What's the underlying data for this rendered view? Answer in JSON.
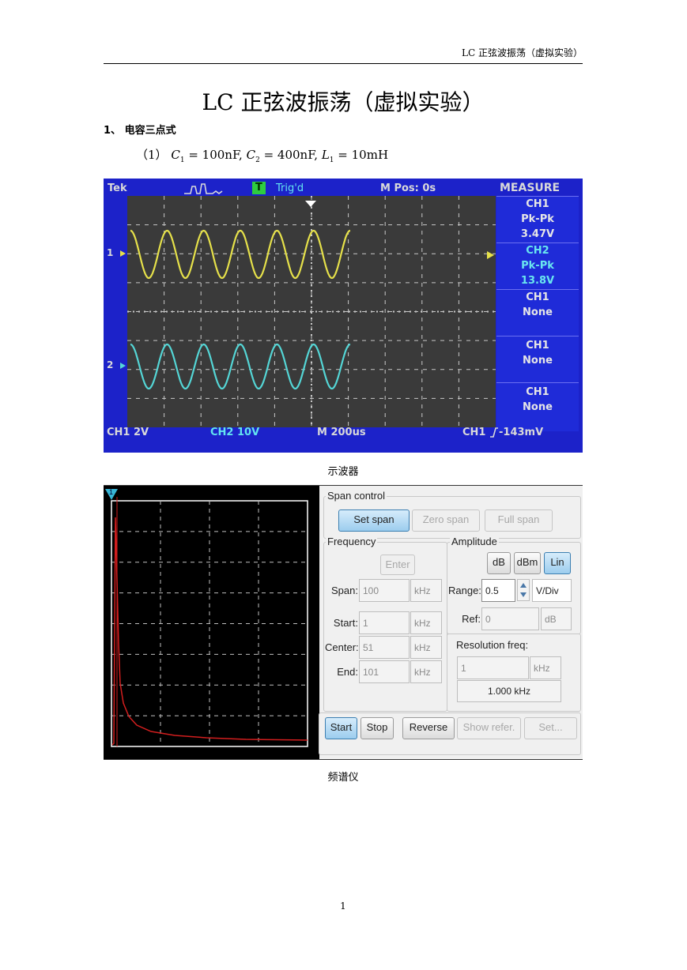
{
  "header": {
    "running_title": "LC 正弦波振荡（虚拟实验）"
  },
  "title": "LC 正弦波振荡（虚拟实验）",
  "section": {
    "heading": "1、 电容三点式"
  },
  "params": {
    "index": "（1）",
    "c1": "100nF",
    "c2": "400nF",
    "l1": "10mH"
  },
  "oscilloscope": {
    "brand": "Tek",
    "trigger_badge": "T",
    "trigger_status": "Trig'd",
    "m_pos": "M Pos: 0s",
    "menu_title": "MEASURE",
    "measurements": [
      {
        "line1": "CH1",
        "line2": "Pk-Pk",
        "line3": "3.47V"
      },
      {
        "line1": "CH2",
        "line2": "Pk-Pk",
        "line3": "13.8V"
      },
      {
        "line1": "CH1",
        "line2": "None",
        "line3": ""
      },
      {
        "line1": "CH1",
        "line2": "None",
        "line3": ""
      },
      {
        "line1": "CH1",
        "line2": "None",
        "line3": ""
      }
    ],
    "ch1_marker": "1",
    "ch2_marker": "2",
    "ch1_scale": "CH1 2V",
    "ch2_scale": "CH2 10V",
    "timebase": "M 200us",
    "trigger_level": "CH1",
    "trigger_value": "-143mV",
    "colors": {
      "background": "#1c22c9",
      "grid": "#c8c8c8",
      "ch1": "#e6e14a",
      "ch2": "#54d6d6"
    },
    "waves": {
      "ch1_cycles": 6,
      "ch2_cycles": 6
    }
  },
  "oscilloscope_caption": "示波器",
  "spectrum": {
    "marker": "1",
    "span_control": {
      "title": "Span control",
      "set_span": "Set span",
      "zero_span": "Zero span",
      "full_span": "Full span"
    },
    "frequency": {
      "title": "Frequency",
      "enter": "Enter",
      "span_label": "Span:",
      "span_value": "100",
      "span_unit": "kHz",
      "start_label": "Start:",
      "start_value": "1",
      "start_unit": "kHz",
      "center_label": "Center:",
      "center_value": "51",
      "center_unit": "kHz",
      "end_label": "End:",
      "end_value": "101",
      "end_unit": "kHz"
    },
    "amplitude": {
      "title": "Amplitude",
      "db": "dB",
      "dbm": "dBm",
      "lin": "Lin",
      "range_label": "Range:",
      "range_value": "0.5",
      "range_unit": "V/Div",
      "ref_label": "Ref:",
      "ref_value": "0",
      "ref_unit": "dB"
    },
    "resolution": {
      "title": "Resolution freq:",
      "value": "1",
      "unit": "kHz",
      "readout": "1.000 kHz"
    },
    "buttons": {
      "start": "Start",
      "stop": "Stop",
      "reverse": "Reverse",
      "show_refer": "Show refer.",
      "set": "Set..."
    },
    "colors": {
      "trace": "#d21e1e",
      "screen": "#000000",
      "grid": "#bfbfbf"
    }
  },
  "spectrum_caption": "频谱仪",
  "page_number": "1"
}
